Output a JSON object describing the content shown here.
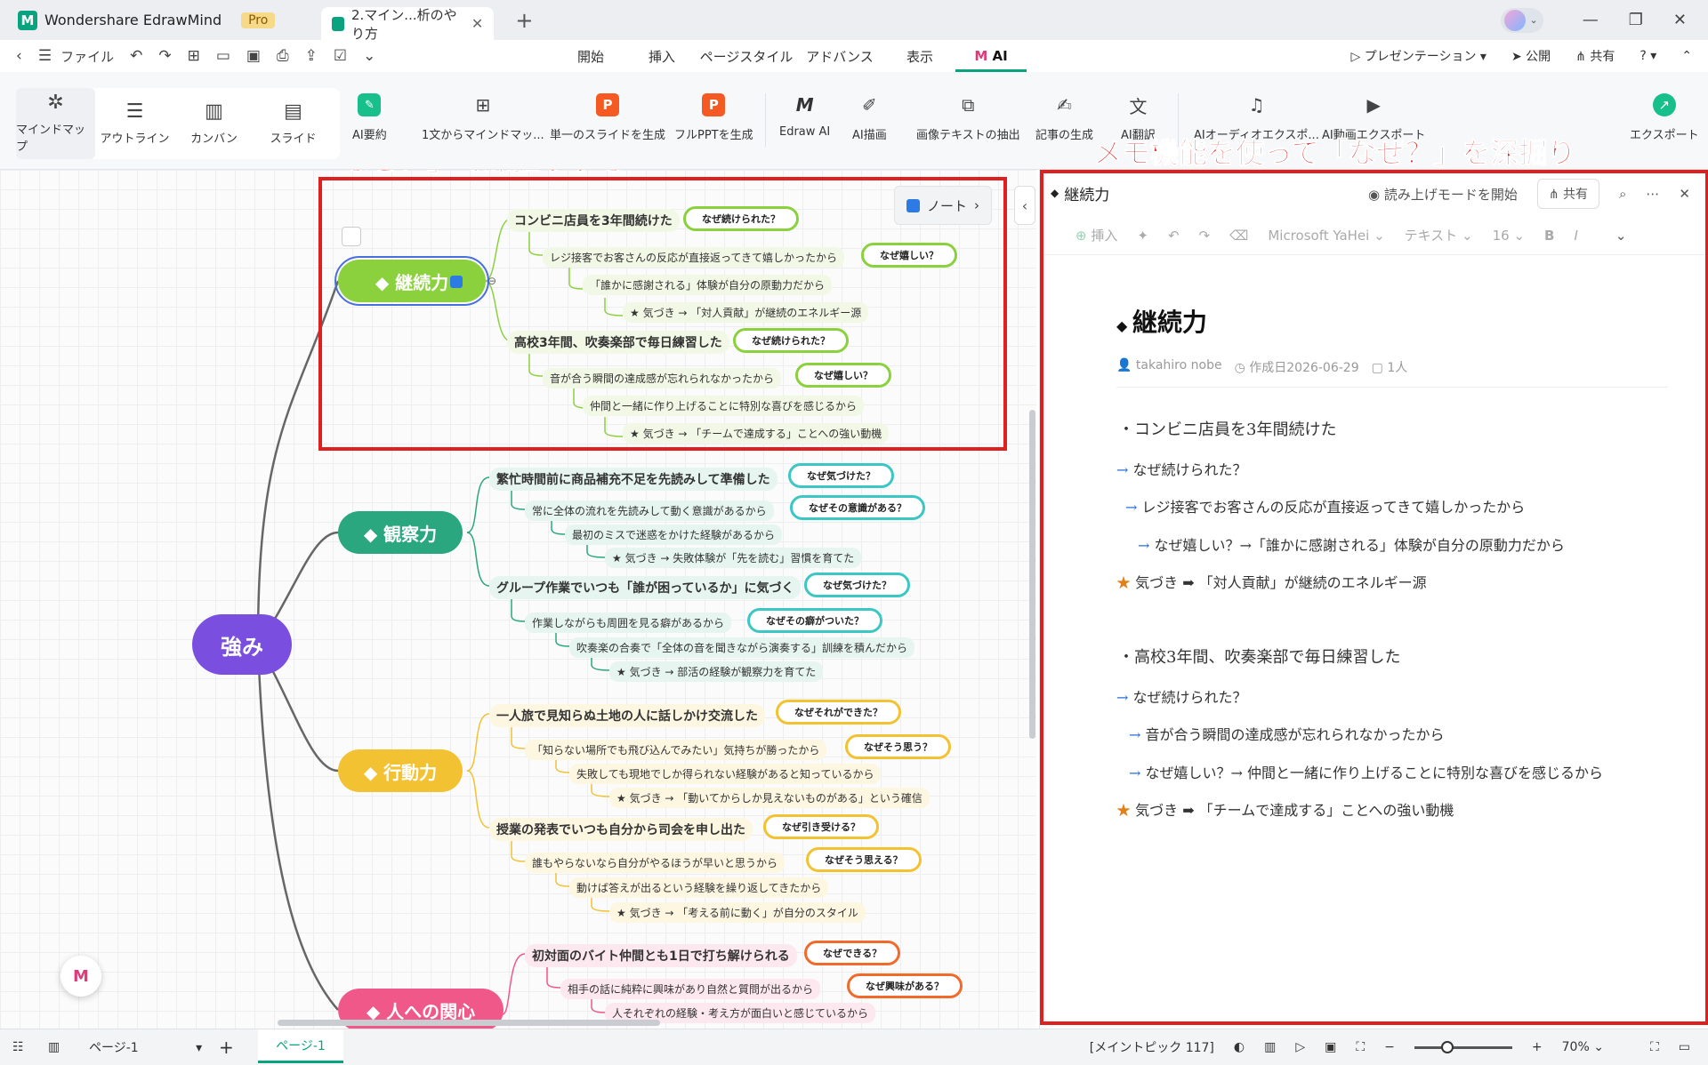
{
  "titlebar": {
    "app_name": "Wondershare EdrawMind",
    "pro_badge": "Pro",
    "doc_tab": "2.マイン...析のやり方"
  },
  "menubar": {
    "file": "ファイル",
    "tabs": [
      "開始",
      "挿入",
      "ページスタイル",
      "アドバンス",
      "表示"
    ],
    "ai_tab": "AI",
    "presentation": "プレゼンテーション",
    "publish": "公開",
    "share": "共有"
  },
  "toolbar": {
    "views": [
      "マインドマップ",
      "アウトライン",
      "カンバン",
      "スライド"
    ],
    "tools": [
      "AI要約",
      "1文からマインドマッ...",
      "単一のスライドを生成",
      "フルPPTを生成",
      "Edraw AI",
      "AI描画",
      "画像テキストの抽出",
      "記事の生成",
      "AI翻訳",
      "AIオーディオエクスポ...",
      "AI動画エクスポート",
      "エクスポート"
    ]
  },
  "annotations": {
    "left": "「なぜ？」で深掘りする",
    "right": "メモ機能を使って「なぜ？」を深掘り"
  },
  "mindmap": {
    "central": "強み",
    "note_button": "ノート",
    "topics": [
      {
        "label": "◆ 継続力",
        "color": "#8bd13e"
      },
      {
        "label": "◆ 観察力",
        "color": "#2aa77f"
      },
      {
        "label": "◆ 行動力",
        "color": "#f2c232"
      },
      {
        "label": "◆ 人への関心",
        "color": "#f0588a"
      }
    ],
    "t1": {
      "s1": "コンビニ店員を3年間続けた",
      "s1_tag": "なぜ続けられた？",
      "d1": "レジ接客でお客さんの反応が直接返ってきて嬉しかったから",
      "d1_tag": "なぜ嬉しい？",
      "d2": "「誰かに感謝される」体験が自分の原動力だから",
      "d3": "★ 気づき → 「対人貢献」が継続のエネルギー源",
      "s2": "高校3年間、吹奏楽部で毎日練習した",
      "s2_tag": "なぜ続けられた？",
      "e1": "音が合う瞬間の達成感が忘れられなかったから",
      "e1_tag": "なぜ嬉しい？",
      "e2": "仲間と一緒に作り上げることに特別な喜びを感じるから",
      "e3": "★ 気づき → 「チームで達成する」ことへの強い動機"
    },
    "t2": {
      "s1": "繁忙時間前に商品補充不足を先読みして準備した",
      "s1_tag": "なぜ気づけた？",
      "d1": "常に全体の流れを先読みして動く意識があるから",
      "d1_tag": "なぜその意識がある？",
      "d2": "最初のミスで迷惑をかけた経験があるから",
      "d3": "★ 気づき → 失敗体験が「先を読む」習慣を育てた",
      "s2": "グループ作業でいつも「誰が困っているか」に気づく",
      "s2_tag": "なぜ気づけた？",
      "e1": "作業しながらも周囲を見る癖があるから",
      "e1_tag": "なぜその癖がついた？",
      "e2": "吹奏楽の合奏で「全体の音を聞きながら演奏する」訓練を積んだから",
      "e3": "★ 気づき → 部活の経験が観察力を育てた"
    },
    "t3": {
      "s1": "一人旅で見知らぬ土地の人に話しかけ交流した",
      "s1_tag": "なぜそれができた？",
      "d1": "「知らない場所でも飛び込んでみたい」気持ちが勝ったから",
      "d1_tag": "なぜそう思う？",
      "d2": "失敗しても現地でしか得られない経験があると知っているから",
      "d3": "★ 気づき → 「動いてからしか見えないものがある」という確信",
      "s2": "授業の発表でいつも自分から司会を申し出た",
      "s2_tag": "なぜ引き受ける？",
      "e1": "誰もやらないなら自分がやるほうが早いと思うから",
      "e1_tag": "なぜそう思える？",
      "e2": "動けば答えが出るという経験を繰り返してきたから",
      "e3": "★ 気づき → 「考える前に動く」が自分のスタイル"
    },
    "t4": {
      "s1": "初対面のバイト仲間とも1日で打ち解けられる",
      "s1_tag": "なぜできる？",
      "d1": "相手の話に純粋に興味があり自然と質問が出るから",
      "d1_tag": "なぜ興味がある？",
      "d2": "人それぞれの経験・考え方が面白いと感じているから"
    }
  },
  "notes": {
    "header_title": "継続力",
    "read_aloud": "読み上げモードを開始",
    "share": "共有",
    "toolbar": {
      "insert": "挿入",
      "font": "Microsoft YaHei",
      "style": "テキスト",
      "size": "16"
    },
    "title": "継続力",
    "author": "takahiro nobe",
    "created": "作成日2026-06-29",
    "readers": "1人",
    "lines": [
      {
        "prefix": "",
        "text": "・コンビニ店員を3年間続けた"
      },
      {
        "prefix": "→",
        "text": " なぜ続けられた？"
      },
      {
        "prefix": "→",
        "text": " レジ接客でお客さんの反応が直接返ってきて嬉しかったから"
      },
      {
        "prefix": "→",
        "text": " なぜ嬉しい？→「誰かに感謝される」体験が自分の原動力だから"
      },
      {
        "prefix": "★",
        "text": " 気づき ➡ 「対人貢献」が継続のエネルギー源"
      },
      {
        "prefix": "",
        "text": "・高校3年間、吹奏楽部で毎日練習した"
      },
      {
        "prefix": "→",
        "text": " なぜ続けられた？"
      },
      {
        "prefix": "→",
        "text": " 音が合う瞬間の達成感が忘れられなかったから"
      },
      {
        "prefix": "→",
        "text": " なぜ嬉しい？→ 仲間と一緒に作り上げることに特別な喜びを感じるから"
      },
      {
        "prefix": "★",
        "text": " 気づき ➡ 「チームで達成する」ことへの強い動機"
      }
    ]
  },
  "statusbar": {
    "page_select": "ページ-1",
    "active_page": "ページ-1",
    "main_topic": "[メイントピック 117]",
    "zoom": "70%"
  }
}
